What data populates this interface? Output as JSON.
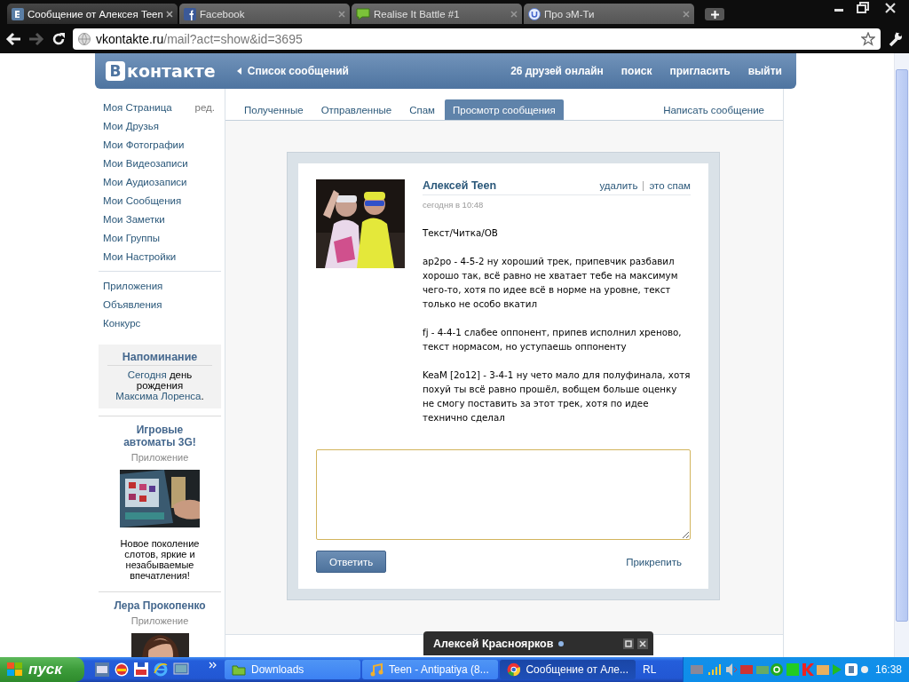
{
  "browser": {
    "tabs": [
      {
        "title": "Сообщение от Алексея Teen",
        "selected": true
      },
      {
        "title": "Facebook",
        "selected": false
      },
      {
        "title": "Realise It Battle #1",
        "selected": false
      },
      {
        "title": "Про эМ-Ти",
        "selected": false
      }
    ],
    "url_host": "vkontakte.ru",
    "url_path": "/mail?act=show&id=3695"
  },
  "header": {
    "logo_letter": "В",
    "logo_text": "контакте",
    "back_link": "Список сообщений",
    "links": [
      "26 друзей онлайн",
      "поиск",
      "пригласить",
      "выйти"
    ]
  },
  "sidebar": {
    "items": [
      {
        "label": "Моя Страница",
        "edit": "ред."
      },
      {
        "label": "Мои Друзья"
      },
      {
        "label": "Мои Фотографии"
      },
      {
        "label": "Мои Видеозаписи"
      },
      {
        "label": "Мои Аудиозаписи"
      },
      {
        "label": "Мои Сообщения"
      },
      {
        "label": "Мои Заметки"
      },
      {
        "label": "Мои Группы"
      },
      {
        "label": "Мои Настройки"
      }
    ],
    "extra_items": [
      "Приложения",
      "Объявления",
      "Конкурс"
    ]
  },
  "reminder": {
    "title": "Напоминание",
    "parts": [
      {
        "kind": "link",
        "text": "Сегодня"
      },
      {
        "kind": "plain",
        "text": " день рождения "
      },
      {
        "kind": "link",
        "text": "Максима Лоренса"
      },
      {
        "kind": "plain",
        "text": "."
      }
    ]
  },
  "ads": [
    {
      "title": "Игровые автоматы 3G!",
      "subtitle": "Приложение",
      "kind": "slots",
      "text": "Новое поколение слотов, яркие и незабываемые впечатления!"
    },
    {
      "title": "Лера Прокопенко",
      "subtitle": "Приложение",
      "kind": "portrait"
    }
  ],
  "mail_tabs": [
    {
      "label": "Полученные",
      "selected": false
    },
    {
      "label": "Отправленные",
      "selected": false
    },
    {
      "label": "Спам",
      "selected": false
    },
    {
      "label": "Просмотр сообщения",
      "selected": true
    }
  ],
  "compose_link": "Написать сообщение",
  "message": {
    "author": "Алексей Teen",
    "date": "сегодня в 10:48",
    "actions": [
      "удалить",
      "это спам"
    ],
    "paragraphs": [
      "Текст/Читка/ОВ",
      "ap2po - 4-5-2 ну хороший трек, припевчик разбавил хорошо так, всё равно не хватает тебе на максимум чего-то, хотя по идее всё в норме на уровне, текст только не особо вкатил",
      "fj - 4-4-1 слабее оппонент, припев исполнил хреново, текст нормасом, но уступаешь оппоненту",
      "KeaM [2o12] - 3-4-1 ну чето мало для полуфинала, хотя похуй ты всё равно прошёл, вобщем больше оценку не смогу поставить за этот трек, хотя по идее технично сделал"
    ]
  },
  "reply": {
    "button": "Ответить",
    "attach": "Прикрепить"
  },
  "chat_popup": {
    "name": "Алексей Красноярков",
    "online": true
  },
  "taskbar": {
    "start": "пуск",
    "windows": [
      {
        "title": "Downloads",
        "selected": false
      },
      {
        "title": "Teen - Antipatiya (8...",
        "selected": false
      },
      {
        "title": "Сообщение от Але...",
        "selected": true
      }
    ],
    "language": "RL",
    "clock": "16:38"
  }
}
